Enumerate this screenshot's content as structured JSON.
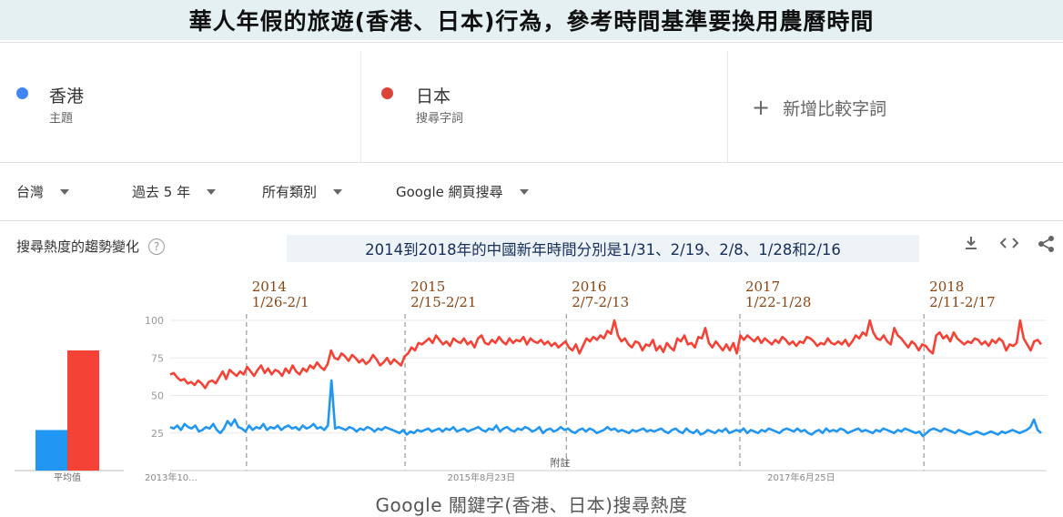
{
  "header": {
    "title": "華人年假的旅遊(香港、日本)行為，參考時間基準要換用農曆時間"
  },
  "terms": [
    {
      "name": "香港",
      "sub": "主題",
      "color": "#4285f4"
    },
    {
      "name": "日本",
      "sub": "搜尋字詞",
      "color": "#db4437"
    }
  ],
  "add_term": {
    "label": "新增比較字詞"
  },
  "filters": {
    "region": "台灣",
    "period": "過去 5 年",
    "category": "所有類別",
    "search_type": "Google 網頁搜尋"
  },
  "section": {
    "title": "搜尋熱度的趨勢變化",
    "help": "?"
  },
  "note": "2014到2018年的中國新年時間分別是1/31、2/19、2/8、1/28和2/16",
  "footer": {
    "title": "Google 關鍵字(香港、日本)搜尋熱度"
  },
  "chart_data": {
    "type": "line",
    "y_ticks": [
      25,
      50,
      75,
      100
    ],
    "ylim": [
      0,
      100
    ],
    "x_tick_labels": [
      "2013年10...",
      "2015年8月23日",
      "2017年6月25日"
    ],
    "grid": true,
    "average_bars": {
      "label": "平均值",
      "values": [
        27,
        80
      ],
      "colors": [
        "#2196f3",
        "#f44336"
      ]
    },
    "annotation": "附註",
    "events": [
      {
        "year": "2014",
        "range": "1/26-2/1"
      },
      {
        "year": "2015",
        "range": "2/15-2/21"
      },
      {
        "year": "2016",
        "range": "2/7-2/13"
      },
      {
        "year": "2017",
        "range": "1/22-1/28"
      },
      {
        "year": "2018",
        "range": "2/11-2/17"
      }
    ],
    "series": [
      {
        "name": "香港",
        "color": "#2196f3",
        "values": [
          29,
          28,
          30,
          27,
          31,
          29,
          28,
          30,
          26,
          27,
          29,
          28,
          31,
          27,
          25,
          28,
          33,
          30,
          34,
          29,
          28,
          26,
          30,
          27,
          29,
          28,
          31,
          27,
          29,
          28,
          30,
          27,
          29,
          30,
          28,
          29,
          27,
          30,
          28,
          29,
          31,
          28,
          29,
          27,
          30,
          60,
          28,
          29,
          28,
          27,
          29,
          28,
          26,
          28,
          27,
          29,
          28,
          26,
          28,
          27,
          29,
          28,
          27,
          26,
          25,
          27,
          24,
          26,
          25,
          27,
          26,
          27,
          28,
          26,
          27,
          28,
          26,
          28,
          27,
          29,
          26,
          27,
          28,
          26,
          27,
          28,
          29,
          27,
          26,
          28,
          27,
          30,
          26,
          28,
          29,
          27,
          26,
          28,
          27,
          29,
          28,
          26,
          27,
          29,
          25,
          27,
          28,
          26,
          27,
          29,
          27,
          28,
          26,
          25,
          27,
          28,
          26,
          28,
          27,
          25,
          26,
          27,
          29,
          27,
          28,
          26,
          27,
          26,
          25,
          27,
          26,
          27,
          28,
          26,
          27,
          26,
          27,
          28,
          26,
          25,
          27,
          28,
          26,
          25,
          28,
          26,
          25,
          27,
          24,
          25,
          27,
          26,
          25,
          27,
          26,
          28,
          25,
          26,
          27,
          26,
          28,
          25,
          27,
          26,
          25,
          27,
          26,
          28,
          27,
          26,
          25,
          27,
          28,
          27,
          26,
          28,
          26,
          27,
          25,
          24,
          26,
          27,
          25,
          28,
          26,
          27,
          26,
          28,
          27,
          25,
          26,
          27,
          28,
          26,
          27,
          26,
          25,
          27,
          26,
          28,
          27,
          26,
          25,
          27,
          26,
          28,
          27,
          26,
          25,
          26,
          23,
          25,
          27,
          28,
          27,
          26,
          28,
          27,
          26,
          25,
          27,
          26,
          25,
          24,
          25,
          26,
          25,
          24,
          25,
          26,
          25,
          24,
          26,
          25,
          26,
          27,
          26,
          25,
          26,
          27,
          29,
          34,
          27,
          25
        ]
      },
      {
        "name": "日本",
        "color": "#f44336",
        "values": [
          64,
          65,
          62,
          60,
          61,
          58,
          59,
          57,
          60,
          58,
          55,
          59,
          60,
          58,
          62,
          66,
          61,
          67,
          65,
          63,
          66,
          64,
          69,
          66,
          63,
          67,
          70,
          65,
          68,
          64,
          67,
          66,
          63,
          68,
          65,
          70,
          66,
          64,
          68,
          66,
          70,
          68,
          72,
          69,
          67,
          71,
          80,
          75,
          74,
          78,
          76,
          73,
          77,
          75,
          72,
          74,
          71,
          73,
          77,
          74,
          70,
          72,
          75,
          71,
          74,
          72,
          70,
          76,
          78,
          82,
          80,
          85,
          84,
          86,
          88,
          85,
          90,
          87,
          84,
          86,
          83,
          88,
          86,
          85,
          88,
          84,
          86,
          82,
          88,
          90,
          85,
          84,
          87,
          85,
          89,
          86,
          84,
          88,
          85,
          87,
          86,
          89,
          84,
          88,
          86,
          85,
          87,
          84,
          86,
          83,
          85,
          82,
          84,
          86,
          82,
          80,
          84,
          78,
          83,
          88,
          86,
          89,
          87,
          90,
          88,
          93,
          91,
          100,
          90,
          86,
          88,
          84,
          82,
          86,
          85,
          80,
          84,
          83,
          87,
          80,
          83,
          79,
          85,
          82,
          80,
          88,
          86,
          90,
          84,
          85,
          82,
          89,
          88,
          95,
          85,
          82,
          86,
          83,
          80,
          84,
          80,
          85,
          78,
          90,
          87,
          90,
          88,
          86,
          89,
          85,
          88,
          86,
          84,
          87,
          85,
          89,
          87,
          84,
          86,
          83,
          86,
          85,
          89,
          88,
          86,
          83,
          85,
          84,
          88,
          85,
          84,
          86,
          84,
          87,
          83,
          86,
          90,
          88,
          92,
          90,
          100,
          92,
          88,
          87,
          90,
          86,
          84,
          95,
          90,
          88,
          85,
          82,
          86,
          84,
          80,
          84,
          83,
          80,
          78,
          90,
          92,
          88,
          90,
          86,
          92,
          88,
          86,
          84,
          86,
          85,
          88,
          87,
          84,
          86,
          83,
          87,
          85,
          88,
          86,
          80,
          84,
          83,
          85,
          100,
          88,
          84,
          80,
          86,
          87,
          84
        ]
      }
    ]
  }
}
